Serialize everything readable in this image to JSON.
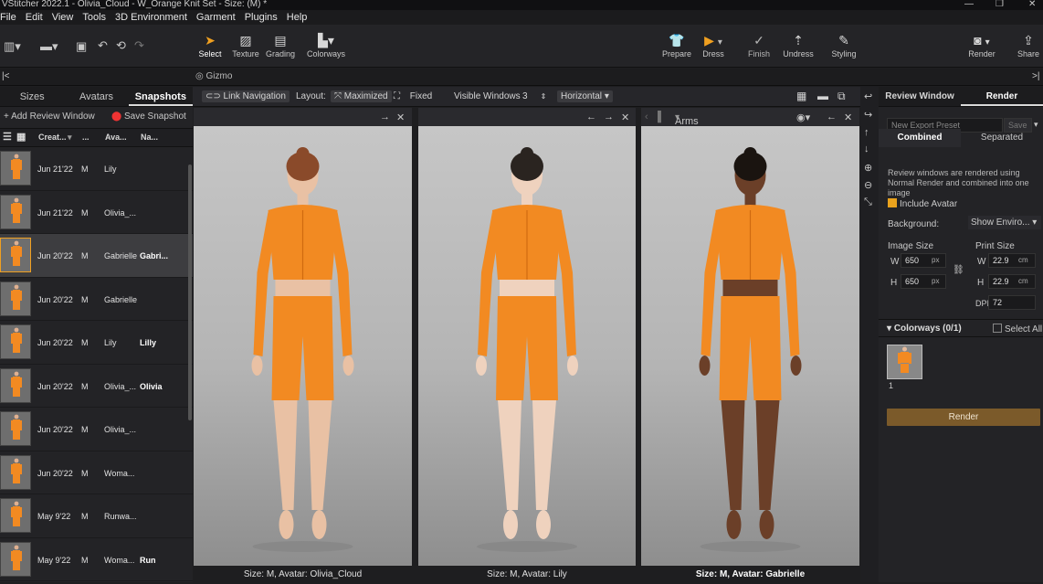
{
  "titlebar": {
    "title": "VStitcher 2022.1 - Olivia_Cloud - W_Orange Knit Set - Size: (M) *"
  },
  "menu": [
    "File",
    "Edit",
    "View",
    "Tools",
    "3D Environment",
    "Garment",
    "Plugins",
    "Help"
  ],
  "tools_left": [
    {
      "label": "Select",
      "icon": "cursor-icon",
      "active": true
    },
    {
      "label": "Texture",
      "icon": "texture-icon"
    },
    {
      "label": "Grading",
      "icon": "grading-icon"
    },
    {
      "label": "Colorways",
      "icon": "colorways-icon"
    }
  ],
  "tools_mid": [
    {
      "label": "Prepare",
      "icon": "shirt-icon"
    },
    {
      "label": "Dress",
      "icon": "play-icon"
    },
    {
      "label": "Finish",
      "icon": "check-icon"
    },
    {
      "label": "Undress",
      "icon": "undress-icon"
    },
    {
      "label": "Styling",
      "icon": "styling-icon"
    }
  ],
  "tools_right": [
    {
      "label": "Render",
      "icon": "camera-icon"
    },
    {
      "label": "Share",
      "icon": "share-icon"
    }
  ],
  "gizmo": "Gizmo",
  "left": {
    "tabs": [
      "Sizes",
      "Avatars",
      "Snapshots"
    ],
    "add_review": "Add Review Window",
    "save_snapshot": "Save Snapshot",
    "columns": [
      "Creat...",
      "...",
      "Ava...",
      "Na..."
    ],
    "rows": [
      {
        "date": "Jun 21'22",
        "size": "M",
        "avatar": "Lily",
        "name": ""
      },
      {
        "date": "Jun 21'22",
        "size": "M",
        "avatar": "Olivia_...",
        "name": ""
      },
      {
        "date": "Jun 20'22",
        "size": "M",
        "avatar": "Gabrielle",
        "name": "Gabri...",
        "selected": true
      },
      {
        "date": "Jun 20'22",
        "size": "M",
        "avatar": "Gabrielle",
        "name": ""
      },
      {
        "date": "Jun 20'22",
        "size": "M",
        "avatar": "Lily",
        "name": "Lilly"
      },
      {
        "date": "Jun 20'22",
        "size": "M",
        "avatar": "Olivia_...",
        "name": "Olivia"
      },
      {
        "date": "Jun 20'22",
        "size": "M",
        "avatar": "Olivia_...",
        "name": ""
      },
      {
        "date": "Jun 20'22",
        "size": "M",
        "avatar": "Woma...",
        "name": ""
      },
      {
        "date": "May 9'22",
        "size": "M",
        "avatar": "Runwa...",
        "name": ""
      },
      {
        "date": "May 9'22",
        "size": "M",
        "avatar": "Woma...",
        "name": "Run"
      }
    ]
  },
  "viewbar": {
    "link_navigation": "Link Navigation",
    "layout_label": "Layout:",
    "maximized": "Maximized",
    "fixed": "Fixed",
    "visible_windows_label": "Visible Windows",
    "visible_windows_value": "3",
    "orientation": "Horizontal"
  },
  "viewports": [
    {
      "footer": "Size: M, Avatar: Olivia_Cloud",
      "header_text": "",
      "skin": "#e9c1a4",
      "hair": "#8a4a2a"
    },
    {
      "footer": "Size: M, Avatar: Lily",
      "header_text": "",
      "skin": "#efd2be",
      "hair": "#2a2420"
    },
    {
      "footer": "Size: M, Avatar: Gabrielle",
      "header_text": "Arms Down",
      "skin": "#6b3f28",
      "hair": "#1a1410"
    }
  ],
  "right": {
    "tabs": [
      "Review Window",
      "Render"
    ],
    "preset_placeholder": "New Export Preset",
    "save": "Save",
    "modes": [
      "Combined",
      "Separated"
    ],
    "description": "Review windows are rendered using Normal Render and combined into one image",
    "include_avatar": "Include Avatar",
    "background_label": "Background:",
    "background_value": "Show Enviro...",
    "image_size_label": "Image Size",
    "print_size_label": "Print Size",
    "img_w": "650",
    "img_h": "650",
    "px": "px",
    "print_w": "22.9",
    "print_h": "22.9",
    "cm": "cm",
    "dpi_label": "DPI",
    "dpi": "72",
    "w": "W",
    "h": "H",
    "colorways_label": "Colorways (0/1)",
    "select_all": "Select All",
    "colorway_index": "1",
    "render_button": "Render"
  },
  "colors": {
    "accent": "#f0a020",
    "garment": "#f28a22",
    "render_btn": "#7b5a2a"
  }
}
